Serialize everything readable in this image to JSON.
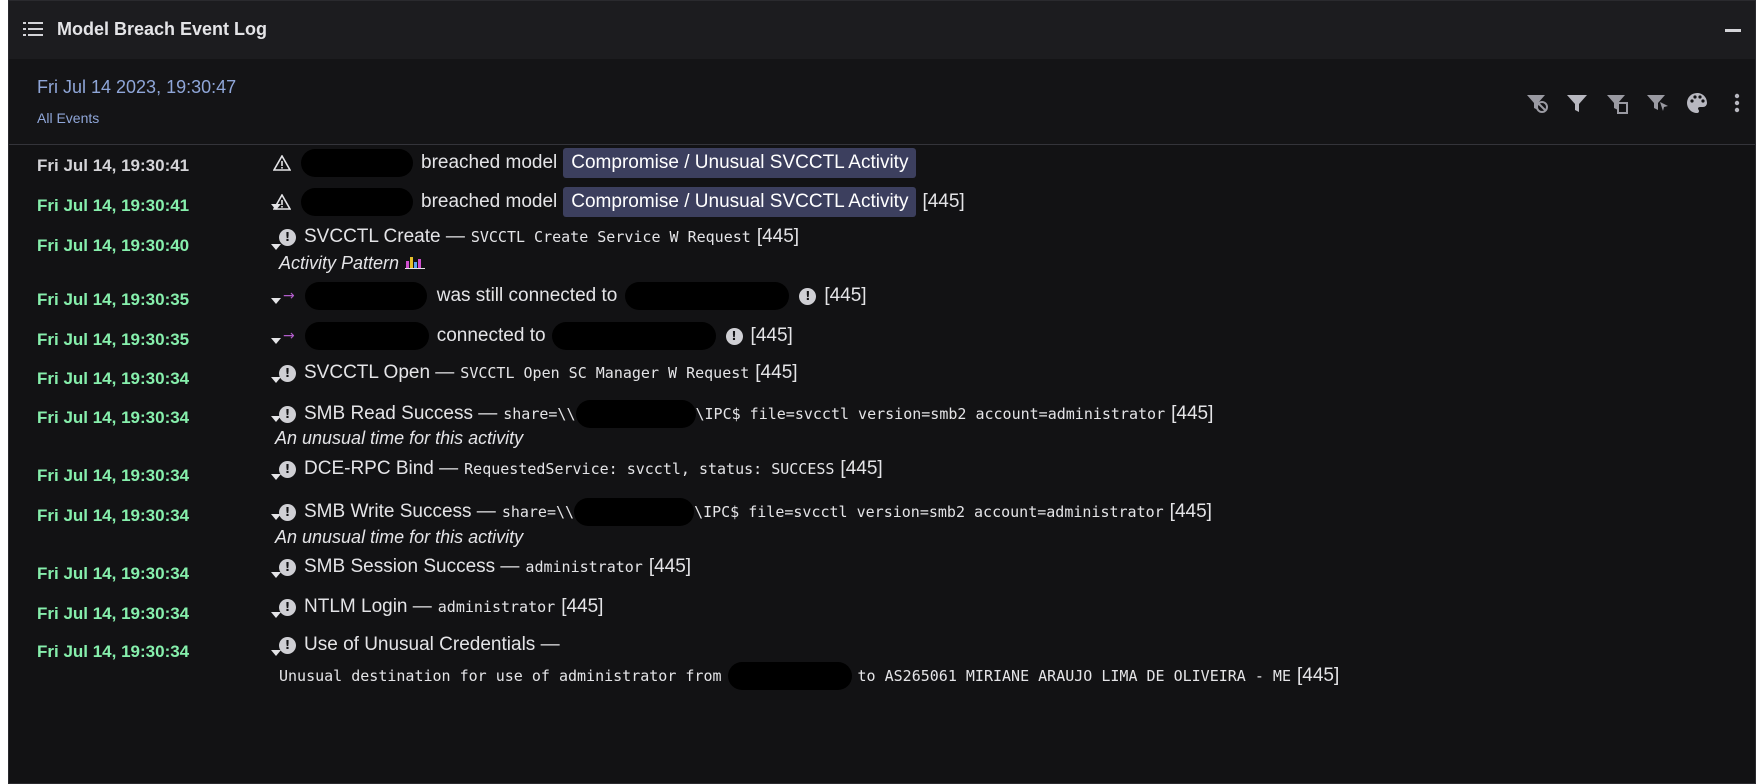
{
  "window": {
    "title": "Model Breach Event Log"
  },
  "header": {
    "date": "Fri Jul 14 2023, 19:30:47",
    "filter_label": "All Events"
  },
  "toolbar": {
    "icons": [
      "filter-clear-icon",
      "filter-icon",
      "filter-doc-icon",
      "filter-pointer-icon",
      "palette-icon",
      "more-vert-icon"
    ]
  },
  "colors": {
    "timestamp_green": "#86efac",
    "model_tag_bg": "#3c3f5e",
    "header_blue": "#8fa6d8"
  },
  "events": [
    {
      "ts": "Fri Jul 14, 19:30:41",
      "text_a": "breached model",
      "tag": "Compromise / Unusual SVCCTL Activity"
    },
    {
      "ts": "Fri Jul 14, 19:30:41",
      "text_a": "breached model",
      "tag": "Compromise / Unusual SVCCTL Activity",
      "port": "[445]"
    },
    {
      "ts": "Fri Jul 14, 19:30:40",
      "text_a": "SVCCTL Create —",
      "mono": "SVCCTL Create Service W Request",
      "port": "[445]",
      "note": "Activity Pattern"
    },
    {
      "ts": "Fri Jul 14, 19:30:35",
      "text_a": "was still connected to",
      "port": "[445]"
    },
    {
      "ts": "Fri Jul 14, 19:30:35",
      "text_a": "connected to",
      "port": "[445]"
    },
    {
      "ts": "Fri Jul 14, 19:30:34",
      "text_a": "SVCCTL Open —",
      "mono": "SVCCTL Open SC Manager W Request",
      "port": "[445]"
    },
    {
      "ts": "Fri Jul 14, 19:30:34",
      "text_a": "SMB Read Success —",
      "mono_a": "share=\\\\",
      "mono_b": "\\IPC$ file=svcctl version=smb2 account=administrator",
      "port": "[445]",
      "note": "An unusual time for this activity"
    },
    {
      "ts": "Fri Jul 14, 19:30:34",
      "text_a": "DCE-RPC Bind —",
      "mono": "RequestedService: svcctl, status: SUCCESS",
      "port": "[445]"
    },
    {
      "ts": "Fri Jul 14, 19:30:34",
      "text_a": "SMB Write Success —",
      "mono_a": "share=\\\\",
      "mono_b": "\\IPC$ file=svcctl version=smb2 account=administrator",
      "port": "[445]",
      "note": "An unusual time for this activity"
    },
    {
      "ts": "Fri Jul 14, 19:30:34",
      "text_a": "SMB Session Success —",
      "mono": "administrator",
      "port": "[445]"
    },
    {
      "ts": "Fri Jul 14, 19:30:34",
      "text_a": "NTLM Login —",
      "mono": "administrator",
      "port": "[445]"
    },
    {
      "ts": "Fri Jul 14, 19:30:34",
      "text_a": "Use of Unusual Credentials —",
      "mono_a": "Unusual destination for use of administrator from",
      "mono_b": "to AS265061 MIRIANE ARAUJO LIMA DE OLIVEIRA - ME",
      "port": "[445]"
    }
  ]
}
